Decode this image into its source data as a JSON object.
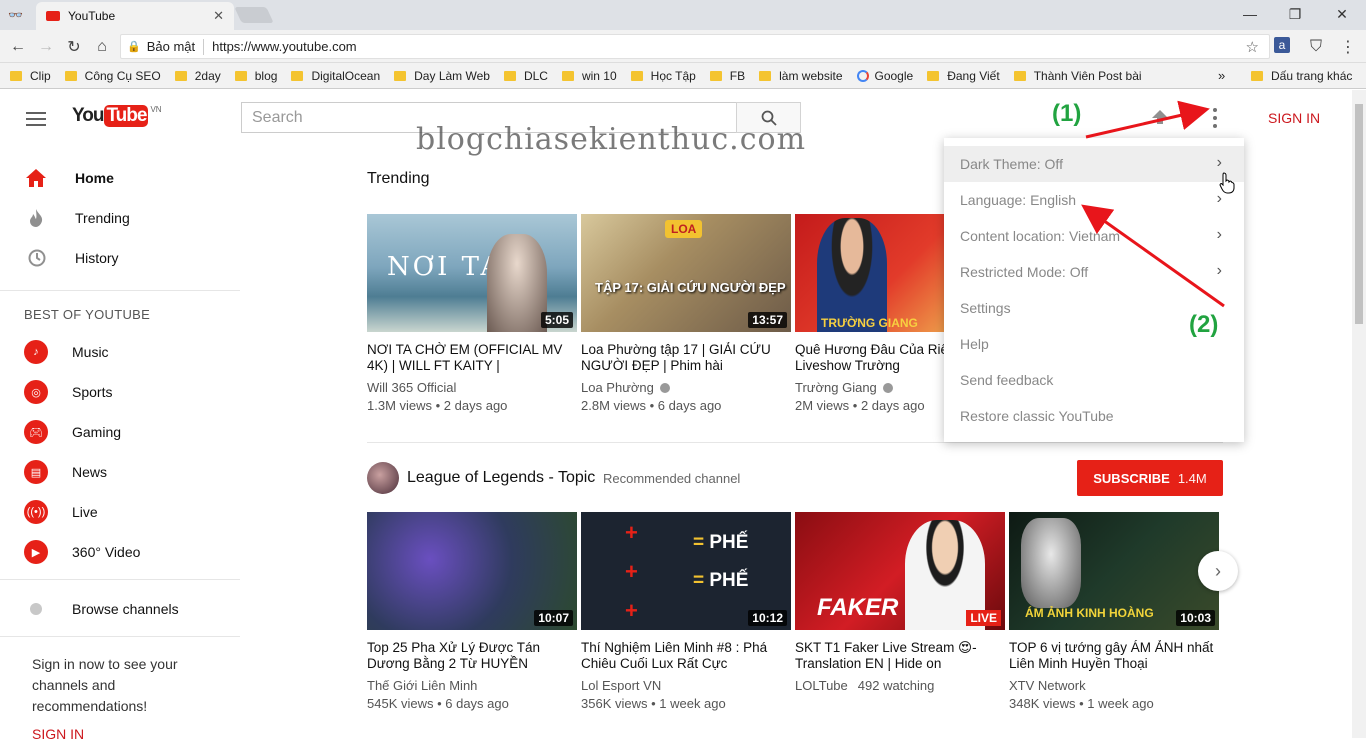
{
  "browser": {
    "tab_title": "YouTube",
    "security_label": "Bảo mật",
    "url": "https://www.youtube.com",
    "bookmarks": [
      "Clip",
      "Công Cụ SEO",
      "2day",
      "blog",
      "DigitalOcean",
      "Day Làm Web",
      "DLC",
      "win 10",
      "Học Tập",
      "FB",
      "làm website",
      "Google",
      "Đang Viết",
      "Thành Viên Post bài"
    ],
    "bookmarks_overflow": "»",
    "other_bookmarks": "Dấu trang khác"
  },
  "header": {
    "logo_text": "You",
    "logo_tube": "Tube",
    "logo_region": "VN",
    "search_placeholder": "Search",
    "sign_in": "SIGN IN"
  },
  "watermark": "blogchiasekienthuc.com",
  "annotations": {
    "one": "(1)",
    "two": "(2)"
  },
  "sidebar": {
    "main": [
      {
        "label": "Home",
        "icon": "home-icon"
      },
      {
        "label": "Trending",
        "icon": "flame-icon"
      },
      {
        "label": "History",
        "icon": "history-icon"
      }
    ],
    "best_heading": "BEST OF YOUTUBE",
    "best": [
      {
        "label": "Music",
        "icon": "music-icon"
      },
      {
        "label": "Sports",
        "icon": "sports-icon"
      },
      {
        "label": "Gaming",
        "icon": "gaming-icon"
      },
      {
        "label": "News",
        "icon": "news-icon"
      },
      {
        "label": "Live",
        "icon": "live-icon"
      },
      {
        "label": "360° Video",
        "icon": "360-icon"
      }
    ],
    "browse": "Browse channels",
    "promo": "Sign in now to see your channels and recommendations!",
    "promo_link": "SIGN IN"
  },
  "trending": {
    "title": "Trending",
    "videos": [
      {
        "thumb_text": "NƠI TA",
        "duration": "5:05",
        "title": "NƠI TA CHỜ EM (OFFICIAL MV 4K) | WILL FT KAITY |",
        "channel": "Will 365 Official",
        "verified": false,
        "meta": "1.3M views • 2 days ago"
      },
      {
        "thumb_text": "TẬP 17: GIẢI CỨU NGƯỜI ĐẸP",
        "duration": "13:57",
        "title": "Loa Phường tập 17 | GIẢI CỨU NGƯỜI ĐẸP | Phim hài",
        "channel": "Loa Phường",
        "verified": true,
        "meta": "2.8M views • 6 days ago"
      },
      {
        "thumb_text": "TRƯỜNG GIANG",
        "duration": "",
        "title": "Quê Hương Đâu Của Riê Minh | Liveshow Trường",
        "channel": "Trường Giang",
        "verified": true,
        "meta": "2M views • 2 days ago"
      }
    ]
  },
  "channel_section": {
    "name": "League of Legends - Topic",
    "tag": "Recommended channel",
    "subscribe": "SUBSCRIBE",
    "subscribers": "1.4M",
    "videos": [
      {
        "thumb_text": "",
        "duration": "10:07",
        "live": "",
        "title": "Top 25 Pha Xử Lý Được Tán Dương Bằng 2 Từ HUYỀN",
        "channel": "Thế Giới Liên Minh",
        "verified": false,
        "meta": "545K views • 6 days ago"
      },
      {
        "thumb_text": "PHẾ",
        "duration": "10:12",
        "live": "",
        "title": "Thí Nghiệm Liên Minh #8 : Phá Chiêu Cuối Lux Rất Cực",
        "channel": "Lol Esport VN",
        "verified": false,
        "meta": "356K views • 1 week ago"
      },
      {
        "thumb_text": "FAKER",
        "duration": "",
        "live": "LIVE",
        "title": "SKT T1 Faker Live Stream 😍- Translation EN | Hide on",
        "channel": "LOLTube",
        "verified": false,
        "meta": "492 watching"
      },
      {
        "thumb_text": "ÁM ẢNH KINH HOÀNG",
        "duration": "10:03",
        "live": "",
        "title": "TOP 6 vị tướng gây ÁM ẢNH nhất Liên Minh Huyền Thoại",
        "channel": "XTV Network",
        "verified": false,
        "meta": "348K views • 1 week ago"
      }
    ]
  },
  "menu": {
    "items": [
      {
        "label": "Dark Theme: Off",
        "chevron": true
      },
      {
        "label": "Language: English",
        "chevron": true
      },
      {
        "label": "Content location: Vietnam",
        "chevron": true
      },
      {
        "label": "Restricted Mode: Off",
        "chevron": true
      },
      {
        "label": "Settings",
        "chevron": false
      },
      {
        "label": "Help",
        "chevron": false
      },
      {
        "label": "Send feedback",
        "chevron": false
      },
      {
        "label": "Restore classic YouTube",
        "chevron": false
      }
    ]
  },
  "colors": {
    "youtube_red": "#e62117",
    "annotation_green": "#21a340",
    "arrow_red": "#e8151b"
  }
}
